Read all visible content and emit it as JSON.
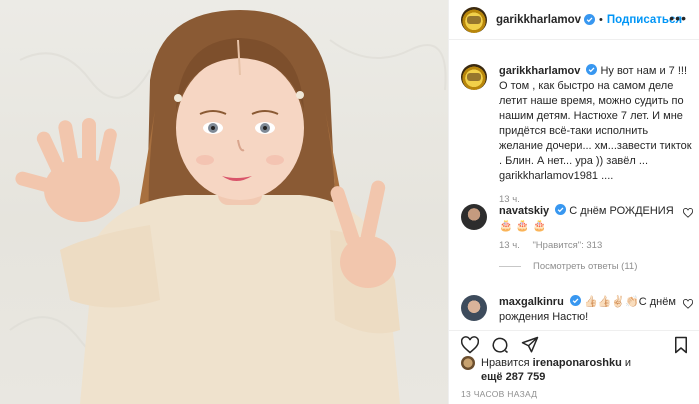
{
  "post": {
    "author": "garikkharlamov",
    "dot": "•",
    "follow_label": "Подписаться",
    "more_icon": "more-horizontal-icon"
  },
  "caption": {
    "author": "garikkharlamov",
    "text": "Ну вот нам и 7 !!! О том , как быстро на самом деле летит наше время, можно судить по нашим детям. Настюхе 7 лет. И мне придётся всё-таки исполнить желание дочери... хм...завести тикток . Блин. А нет... ура )) завёл ... garikkharlamov1981 ....",
    "time": "13 ч."
  },
  "comments": [
    {
      "author": "navatskiy",
      "text": "С днём РОЖДЕНИЯ 🎂 🎂 🎂",
      "time": "13 ч.",
      "likes": "\"Нравится\": 313",
      "replies": "Посмотреть ответы (11)"
    },
    {
      "author": "maxgalkinru",
      "text": "👍🏻👍🏻✌🏻👏🏻С днём рождения Настю!"
    }
  ],
  "likes": {
    "prefix": "Нравится",
    "user": "irenaponaroshku",
    "middle": "и",
    "count_text": "ещё 287 759"
  },
  "posted_ago": "13 ЧАСОВ НАЗАД",
  "colors": {
    "accent": "#0095f6",
    "muted": "#8e8e8e",
    "text": "#262626",
    "verified": "#3897f0"
  }
}
